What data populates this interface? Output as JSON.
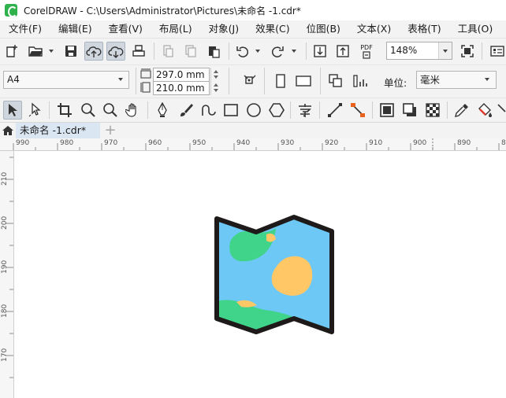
{
  "window": {
    "title": "CorelDRAW - C:\\Users\\Administrator\\Pictures\\未命名 -1.cdr*"
  },
  "menu": [
    {
      "label": "文件(F)"
    },
    {
      "label": "编辑(E)"
    },
    {
      "label": "查看(V)"
    },
    {
      "label": "布局(L)"
    },
    {
      "label": "对象(J)"
    },
    {
      "label": "效果(C)"
    },
    {
      "label": "位图(B)"
    },
    {
      "label": "文本(X)"
    },
    {
      "label": "表格(T)"
    },
    {
      "label": "工具(O)"
    }
  ],
  "toolbar": {
    "zoom": "148%",
    "pdf_label": "PDF"
  },
  "property_bar": {
    "page_size": "A4",
    "width": "297.0 mm",
    "height": "210.0 mm",
    "unit_label": "单位:",
    "unit_value": "毫米"
  },
  "tabs": [
    {
      "label": "未命名 -1.cdr*",
      "active": true
    }
  ],
  "ruler": {
    "horizontal_labels": [
      "990",
      "980",
      "970",
      "960",
      "950",
      "940",
      "930",
      "920",
      "910",
      "900",
      "890",
      "8"
    ],
    "vertical_labels": [
      "210",
      "200",
      "190",
      "180",
      "170"
    ]
  },
  "drawing": {
    "description_colors": {
      "outline": "#1e1a1a",
      "water": "#6ec8f5",
      "land_green": "#3fd48a",
      "land_orange": "#ffc766"
    }
  }
}
